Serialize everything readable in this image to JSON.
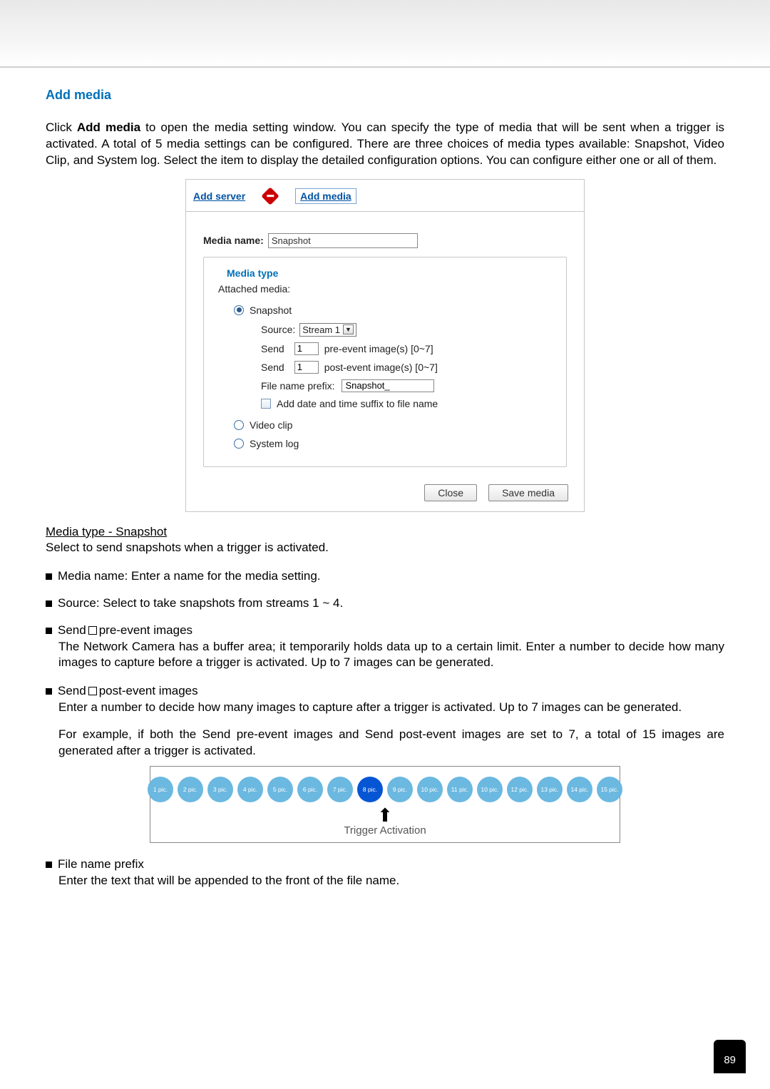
{
  "section_title": "Add media",
  "intro_parts": {
    "p1a": "Click ",
    "p1b": "Add media",
    "p1c": " to open the media setting window. You can specify the type of media that will be sent when a trigger is activated. A total of 5 media settings can be configured. There are three choices of media types available: Snapshot, Video Clip, and System log. Select the item to display the detailed configuration options. You can configure either one or all of them."
  },
  "panel": {
    "tab_add_server": "Add server",
    "tab_add_media": "Add media",
    "media_name_label": "Media name:",
    "media_name_value": "Snapshot",
    "media_type_legend": "Media type",
    "attached_label": "Attached media:",
    "radio_snapshot": "Snapshot",
    "source_label": "Source:",
    "source_value": "Stream 1",
    "send_label": "Send",
    "pre_value": "1",
    "pre_text": "pre-event image(s) [0~7]",
    "post_value": "1",
    "post_text": "post-event image(s) [0~7]",
    "prefix_label": "File name prefix:",
    "prefix_value": "Snapshot_",
    "add_date_label": "Add date and time suffix to file name",
    "radio_video": "Video clip",
    "radio_syslog": "System log",
    "btn_close": "Close",
    "btn_save": "Save media"
  },
  "subheading": "Media type - Snapshot",
  "subtext": "Select to send snapshots when a trigger is activated.",
  "bullets": {
    "b1": "Media name: Enter a name for the media setting.",
    "b2": "Source: Select to take snapshots from streams 1 ~ 4.",
    "b3_lead_a": "Send ",
    "b3_lead_b": " pre-event images",
    "b3_desc": "The Network Camera has a buffer area; it temporarily holds data up to a certain limit. Enter a number to decide how many images to capture before a trigger is activated. Up to 7 images can be generated.",
    "b4_lead_a": "Send ",
    "b4_lead_b": " post-event images",
    "b4_desc1": "Enter a number to decide how many images to capture after a trigger is activated. Up to 7 images can be generated.",
    "b4_desc2": "For example, if both the Send pre-event images and Send post-event images are set to 7, a total of 15 images are generated after a trigger is activated.",
    "b5_lead": "File name prefix",
    "b5_desc": "Enter the text that will be appended to the front of the file name."
  },
  "diagram": {
    "pics": [
      "1 pic.",
      "2 pic.",
      "3 pic.",
      "4 pic.",
      "5 pic.",
      "6 pic.",
      "7 pic.",
      "8 pic.",
      "9 pic.",
      "10 pic.",
      "11 pic.",
      "10 pic.",
      "12 pic.",
      "13 pic.",
      "14 pic.",
      "15 pic."
    ],
    "trigger_index": 7,
    "trigger_label": "Trigger Activation",
    "arrow": "⬆"
  },
  "page_number": "89"
}
